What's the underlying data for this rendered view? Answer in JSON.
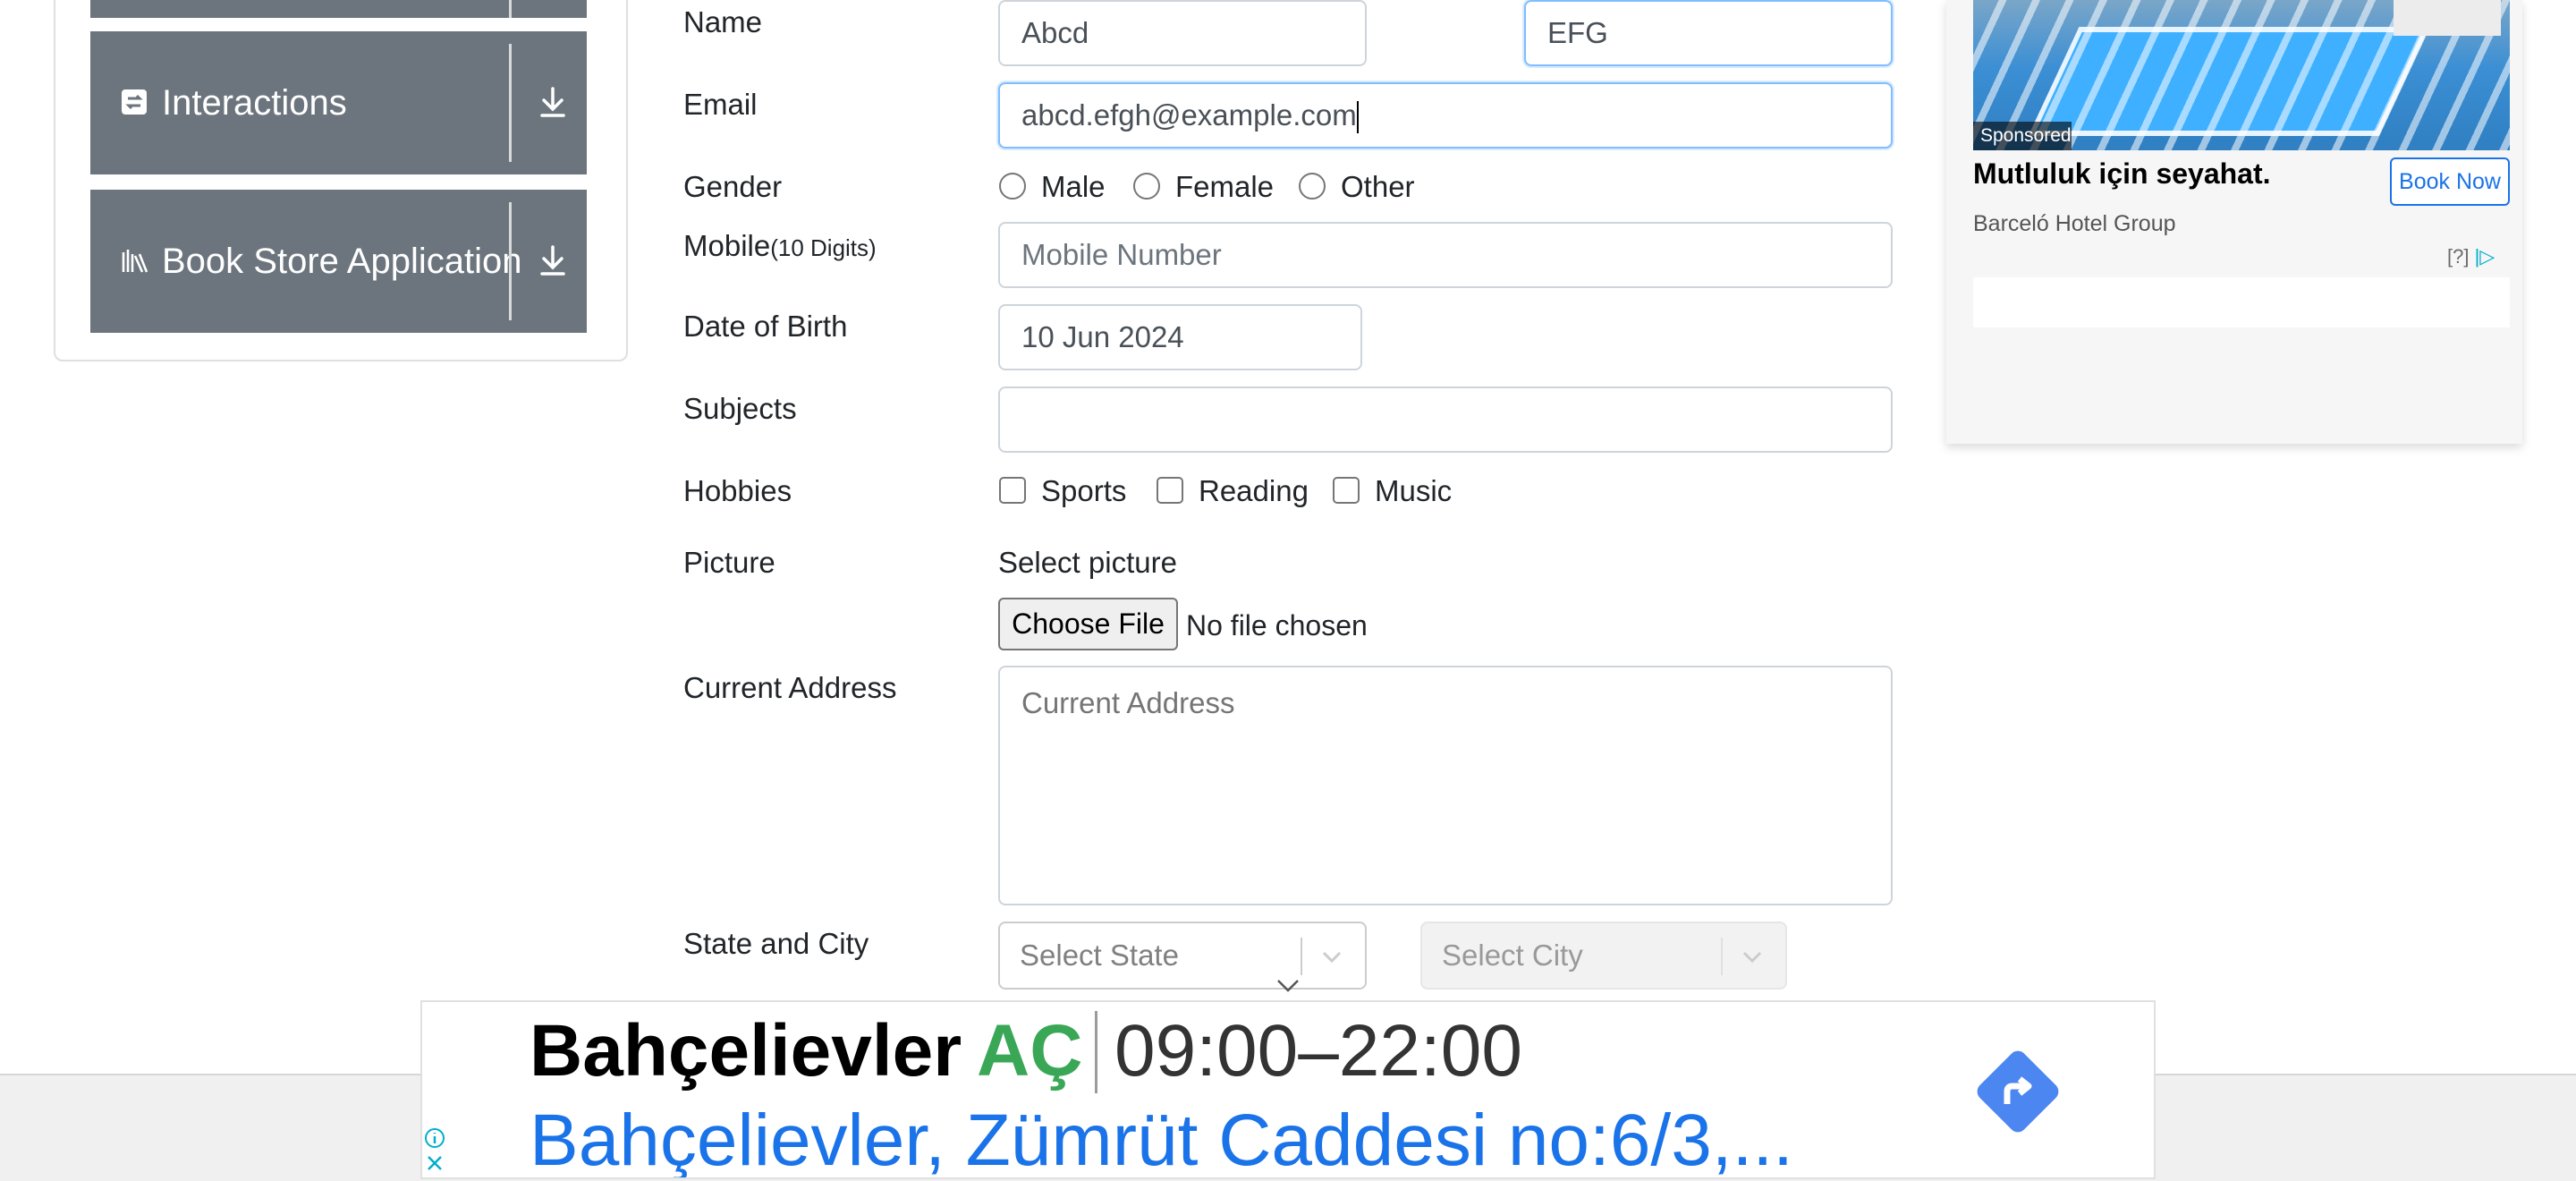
{
  "sidebar": {
    "groups": [
      {
        "label": "Interactions",
        "icon": "swap-icon"
      },
      {
        "label": "Book Store Application",
        "icon": "books-icon"
      }
    ]
  },
  "form": {
    "name_label": "Name",
    "first_name_value": "Abcd",
    "last_name_value": "EFG",
    "email_label": "Email",
    "email_value": "abcd.efgh@example.com",
    "gender_label": "Gender",
    "gender_options": [
      "Male",
      "Female",
      "Other"
    ],
    "mobile_label": "Mobile",
    "mobile_hint": "(10 Digits)",
    "mobile_placeholder": "Mobile Number",
    "dob_label": "Date of Birth",
    "dob_value": "10 Jun 2024",
    "subjects_label": "Subjects",
    "subjects_value": "",
    "hobbies_label": "Hobbies",
    "hobbies_options": [
      "Sports",
      "Reading",
      "Music"
    ],
    "picture_label": "Picture",
    "picture_select_text": "Select picture",
    "file_button_label": "Choose File",
    "file_status": "No file chosen",
    "address_label": "Current Address",
    "address_placeholder": "Current Address",
    "state_city_label": "State and City",
    "state_placeholder": "Select State",
    "city_placeholder": "Select City"
  },
  "ad_right": {
    "sponsored": "Sponsored",
    "title": "Mutluluk için seyahat.",
    "cta": "Book Now",
    "advertiser": "Barceló Hotel Group",
    "marker": "[?]"
  },
  "ad_bottom": {
    "name": "Bahçelievler",
    "status": "AÇ",
    "hours": "09:00–22:00",
    "address": "Bahçelievler, Zümrüt Caddesi no:6/3,..."
  },
  "colors": {
    "sidebar_header": "#6c757d",
    "focus_border": "#80bdff",
    "open_green": "#3aa757",
    "link_blue": "#1a73e8",
    "direction_blue": "#4c86f0"
  }
}
